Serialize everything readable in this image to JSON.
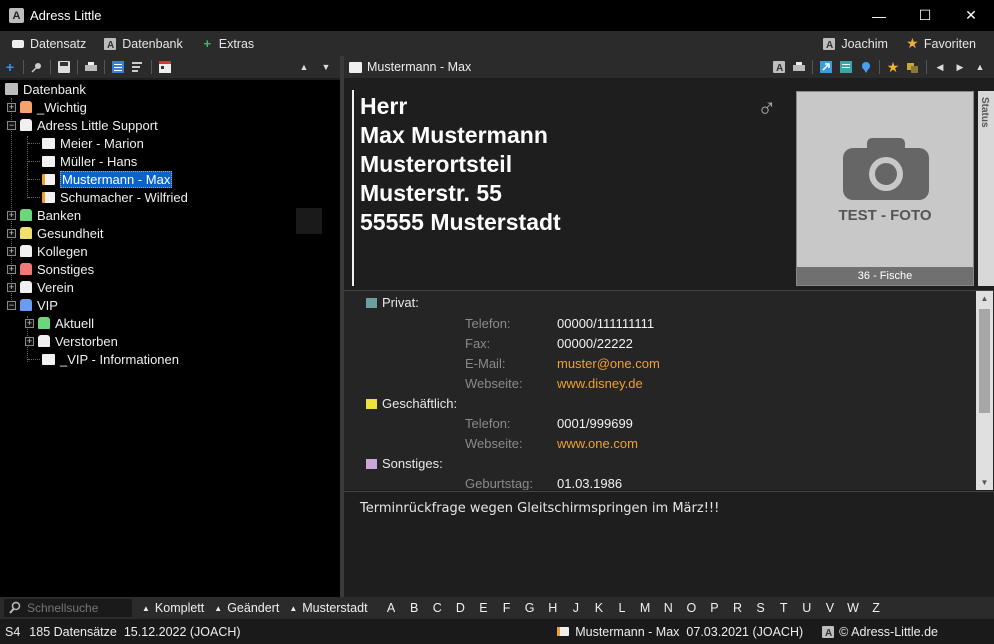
{
  "window": {
    "title": "Adress Little",
    "app_icon": "A",
    "controls": {
      "minimize": "—",
      "maximize": "☐",
      "close": "✕"
    }
  },
  "menubar": {
    "items": [
      "Datensatz",
      "Datenbank",
      "Extras"
    ],
    "user": "Joachim",
    "favorites": "Favoriten"
  },
  "tree": {
    "root": "Datenbank",
    "nodes": {
      "wichtig": {
        "label": "_Wichtig",
        "color": "#f4a46a"
      },
      "support": {
        "label": "Adress Little Support",
        "color": "#f0f0f0"
      },
      "meier": "Meier - Marion",
      "mueller": "Müller - Hans",
      "mustermann": "Mustermann - Max",
      "schumacher": "Schumacher - Wilfried",
      "banken": {
        "label": "Banken",
        "color": "#6dd67d"
      },
      "gesundheit": {
        "label": "Gesundheit",
        "color": "#f0e070"
      },
      "kollegen": {
        "label": "Kollegen",
        "color": "#f0f0f0"
      },
      "sonstiges": {
        "label": "Sonstiges",
        "color": "#f07a7a"
      },
      "verein": {
        "label": "Verein",
        "color": "#f0f0f0"
      },
      "vip": {
        "label": "VIP",
        "color": "#6a9cf0"
      },
      "aktuell": {
        "label": "Aktuell",
        "color": "#6dd67d"
      },
      "verstorben": {
        "label": "Verstorben",
        "color": "#f0f0f0"
      },
      "vip_info": "_VIP - Informationen"
    }
  },
  "record": {
    "header_title": "Mustermann - Max",
    "address_lines": [
      "Herr",
      "Max Mustermann",
      "Musterortsteil",
      "Musterstr. 55",
      "55555 Musterstadt"
    ],
    "gender_symbol": "♂",
    "photo_text": "TEST - FOTO",
    "photo_caption": "36 - Fische",
    "status_tab": "Status"
  },
  "details": {
    "privat": {
      "title": "Privat:",
      "color": "#6aa0a0",
      "rows": [
        {
          "k": "Telefon:",
          "v": "00000/111111111"
        },
        {
          "k": "Fax:",
          "v": "00000/22222"
        },
        {
          "k": "E-Mail:",
          "v": "muster@one.com"
        },
        {
          "k": "Webseite:",
          "v": "www.disney.de"
        }
      ]
    },
    "geschaeftlich": {
      "title": "Geschäftlich:",
      "color": "#f0e040",
      "rows": [
        {
          "k": "Telefon:",
          "v": "0001/999699"
        },
        {
          "k": "Webseite:",
          "v": "www.one.com"
        }
      ]
    },
    "sonstiges": {
      "title": "Sonstiges:",
      "color": "#c8a8d8",
      "rows": [
        {
          "k": "Geburtstag:",
          "v": "01.03.1986"
        }
      ]
    }
  },
  "notes": "Terminrückfrage wegen Gleitschirmspringen im März!!!",
  "filterbar": {
    "search_placeholder": "Schnellsuche",
    "buttons": [
      "Komplett",
      "Geändert",
      "Musterstadt"
    ],
    "letters": [
      "A",
      "B",
      "C",
      "D",
      "E",
      "F",
      "G",
      "H",
      "J",
      "K",
      "L",
      "M",
      "N",
      "O",
      "P",
      "R",
      "S",
      "T",
      "U",
      "V",
      "W",
      "Z"
    ]
  },
  "statusbar": {
    "code": "S4",
    "count": "185 Datensätze",
    "date_user": "15.12.2022 (JOACH)",
    "current_record": "Mustermann - Max",
    "record_date": "07.03.2021 (JOACH)",
    "copyright": "© Adress-Little.de"
  }
}
